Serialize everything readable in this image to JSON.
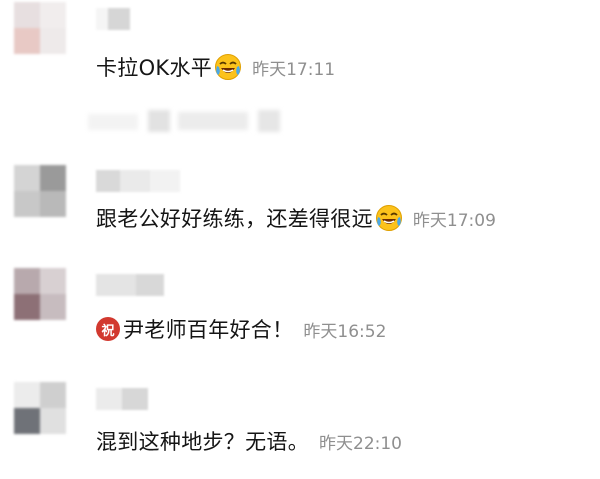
{
  "comments": [
    {
      "text": "卡拉OK水平",
      "emoji": "laughing-crying-emoji",
      "time": "昨天17:11"
    },
    {
      "text": "跟老公好好练练，还差得很远",
      "emoji": "laughing-crying-emoji",
      "time": "昨天17:09"
    },
    {
      "badge": "祝",
      "text": "尹老师百年好合！",
      "time": "昨天16:52"
    },
    {
      "text": "混到这种地步？无语。",
      "time": "昨天22:10"
    }
  ],
  "colors": {
    "text": "#151515",
    "time": "#8f8f8f",
    "badge": "#d2392f",
    "emoji_face": "#fcc21b"
  }
}
